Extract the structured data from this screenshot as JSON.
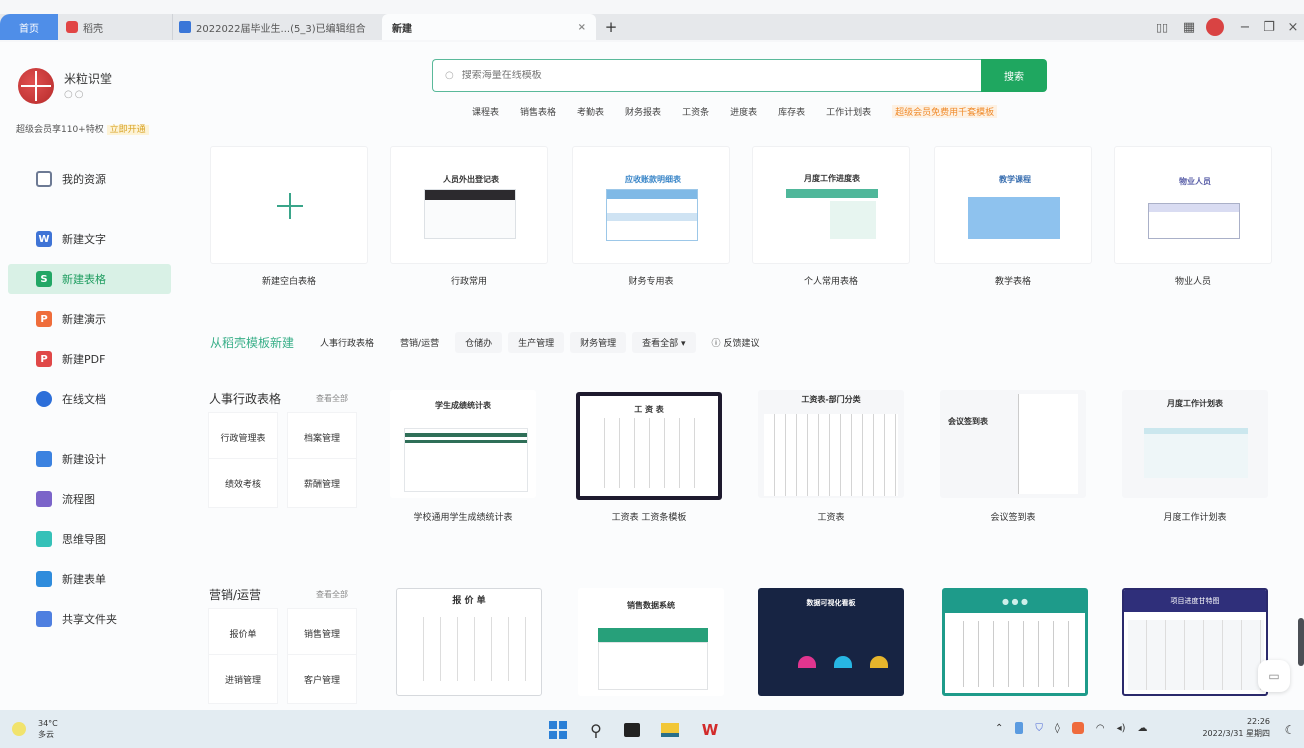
{
  "window": {
    "tabs": [
      {
        "label": "首页",
        "icon": "home"
      },
      {
        "label": "稻壳",
        "icon": "docer-icon"
      },
      {
        "label": "2022022届毕业生...(5_3)已编辑组合",
        "icon": "doc-icon"
      },
      {
        "label": "新建",
        "icon": "none",
        "active": true
      }
    ],
    "tab_close": "×",
    "add_tab": "+",
    "controls": {
      "layout": "▯▯",
      "apps": "▦",
      "minimize": "−",
      "restore": "❐",
      "close": "×"
    }
  },
  "user": {
    "name": "米粒识堂",
    "sub": "○○",
    "note": "超级会员享110+特权",
    "vip_link": "立即开通"
  },
  "sidebar": {
    "items": [
      {
        "label": "我的资源",
        "icon": "resource-icon",
        "color": "#6d7a94"
      },
      {
        "label": "新建文字",
        "icon": "writer-icon",
        "color": "#3f74d6"
      },
      {
        "label": "新建表格",
        "icon": "spreadsheet-icon",
        "color": "#22a765",
        "active": true
      },
      {
        "label": "新建演示",
        "icon": "presentation-icon",
        "color": "#ef6d3b"
      },
      {
        "label": "新建PDF",
        "icon": "pdf-icon",
        "color": "#e04848"
      },
      {
        "label": "在线文档",
        "icon": "online-doc-icon",
        "color": "#2d6fd9"
      },
      {
        "label": "新建设计",
        "icon": "design-icon",
        "color": "#3b82e0"
      },
      {
        "label": "流程图",
        "icon": "flowchart-icon",
        "color": "#7b64c9"
      },
      {
        "label": "思维导图",
        "icon": "mindmap-icon",
        "color": "#35c1b8"
      },
      {
        "label": "新建表单",
        "icon": "form-icon",
        "color": "#2f8cdc"
      },
      {
        "label": "共享文件夹",
        "icon": "shared-folder-icon",
        "color": "#4e7fe0"
      }
    ]
  },
  "search": {
    "placeholder": "搜索海量在线模板",
    "button": "搜索",
    "hot_tags": [
      "课程表",
      "销售表格",
      "考勤表",
      "财务报表",
      "工资条",
      "进度表",
      "库存表",
      "工作计划表"
    ],
    "promo": "超级会员免费用千套模板"
  },
  "featured": [
    {
      "label": "新建空白表格",
      "thumb_title": ""
    },
    {
      "label": "行政常用",
      "thumb_title": "人员外出登记表"
    },
    {
      "label": "财务专用表",
      "thumb_title": "应收账款明细表"
    },
    {
      "label": "个人常用表格",
      "thumb_title": "月度工作进度表"
    },
    {
      "label": "教学表格",
      "thumb_title": "教学课程"
    },
    {
      "label": "物业人员",
      "thumb_title": "物业人员"
    }
  ],
  "filter_bar": {
    "title": "从稻壳模板新建",
    "chips": [
      "人事行政表格",
      "营销/运营",
      "仓储办",
      "生产管理",
      "财务管理",
      "查看全部"
    ],
    "more_arrow": "▾",
    "feedback": "反馈建议"
  },
  "categories": [
    {
      "title": "人事行政表格",
      "more": "查看全部",
      "subcats": [
        "行政管理表",
        "档案管理",
        "绩效考核",
        "薪酬管理"
      ],
      "templates": [
        {
          "label": "学校通用学生成绩统计表",
          "thumb_title": "学生成绩统计表"
        },
        {
          "label": "工资表 工资条模板",
          "thumb_title": "工 资 表"
        },
        {
          "label": "工资表",
          "thumb_title": "工资表-部门分类"
        },
        {
          "label": "会议签到表",
          "thumb_title": "会议签到表"
        },
        {
          "label": "月度工作计划表",
          "thumb_title": "月度工作计划表"
        }
      ]
    },
    {
      "title": "营销/运营",
      "more": "查看全部",
      "subcats": [
        "报价单",
        "销售管理",
        "进销管理",
        "客户管理"
      ],
      "templates": [
        {
          "label": "",
          "thumb_title": "报 价 单"
        },
        {
          "label": "",
          "thumb_title": "销售数据系统"
        },
        {
          "label": "",
          "thumb_title": "数据可视化看板"
        },
        {
          "label": "",
          "thumb_title": "● ● ●"
        },
        {
          "label": "",
          "thumb_title": "项目进度甘特图"
        }
      ]
    }
  ],
  "taskbar": {
    "weather_temp": "34°C",
    "weather_desc": "多云",
    "time": "22:26",
    "date": "2022/3/31 星期四"
  },
  "colors": {
    "accent_green": "#1fa760",
    "tab_blue": "#4f8ee8",
    "promo_orange": "#f08a2a"
  }
}
